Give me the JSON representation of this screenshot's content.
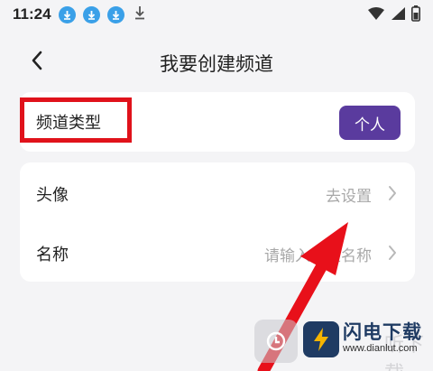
{
  "status_bar": {
    "time": "11:24",
    "icons": [
      "download-badge-icon",
      "download-badge-icon",
      "download-badge-icon",
      "download-icon",
      "wifi-icon",
      "signal-icon",
      "battery-icon"
    ]
  },
  "nav": {
    "back_icon": "chevron-left-icon",
    "title": "我要创建频道"
  },
  "channel_type": {
    "label": "频道类型",
    "selected": "个人"
  },
  "settings": {
    "rows": [
      {
        "label": "头像",
        "value": "去设置",
        "icon": "chevron-right-icon"
      },
      {
        "label": "名称",
        "value": "请输入频道名称",
        "icon": "chevron-right-icon"
      }
    ]
  },
  "watermark": {
    "brand": "闪电下载",
    "url": "www.dianlut.com",
    "ghost_text": "听下载"
  },
  "colors": {
    "background": "#f4f4f6",
    "chip": "#5a3b9e",
    "highlight": "#e0121b",
    "download_badge": "#3aa0e8",
    "muted_text": "#a8a8a8",
    "brand": "#1f3b63"
  }
}
